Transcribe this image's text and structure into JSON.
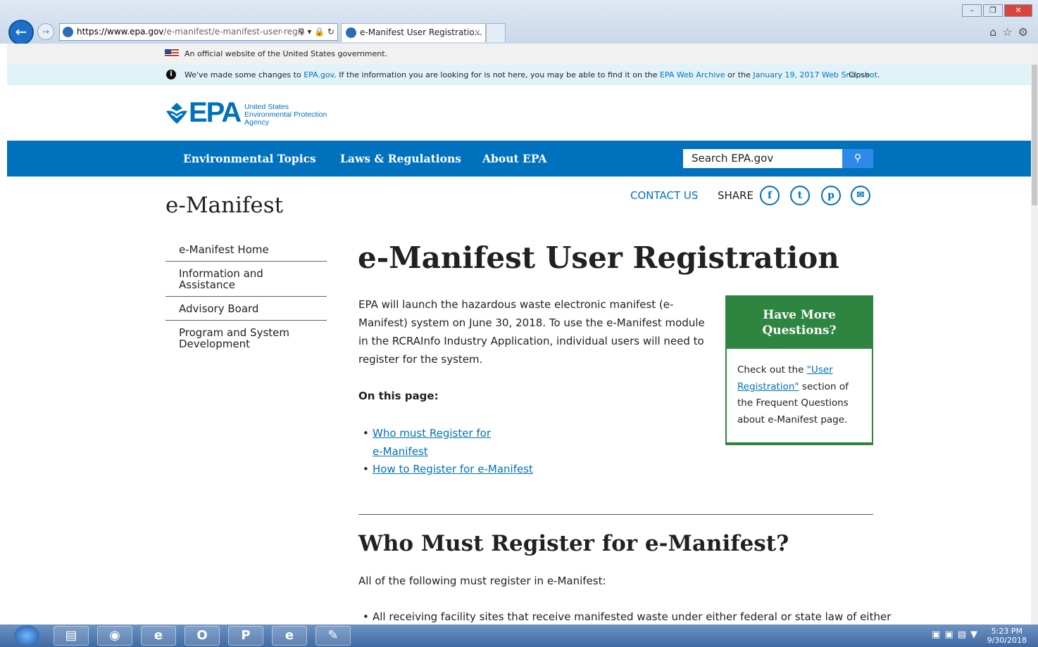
{
  "browser": {
    "url_domain": "https://www.epa.gov",
    "url_path": "/e-manifest/e-manifest-user-regis",
    "tab_title": "e-Manifest User Registratio...",
    "tab_close": "×",
    "window_minimize": "–",
    "window_restore": "❐",
    "window_close": "✕",
    "address_tools": "⚲ ▾ 🔒 ↻"
  },
  "gov_banner": {
    "text": "An official website of the United States government."
  },
  "notice": {
    "text_before": "We've made some changes to ",
    "link1": "EPA.gov",
    "text_mid1": ". If the information you are looking for is not here, you may be able to find it on the ",
    "link2": "EPA Web Archive",
    "text_mid2": " or the ",
    "link3": "January 19, 2017 Web Snapshot",
    "text_after": ".",
    "close": "Close"
  },
  "logo": {
    "word": "EPA",
    "agency_line1": "United States",
    "agency_line2": "Environmental Protection",
    "agency_line3": "Agency"
  },
  "nav": {
    "items": [
      "Environmental Topics",
      "Laws & Regulations",
      "About EPA"
    ],
    "search_placeholder": "Search EPA.gov",
    "search_button_icon": "search-icon"
  },
  "site_title": "e-Manifest",
  "header_links": {
    "contact": "CONTACT US",
    "share": "SHARE"
  },
  "sidenav": {
    "items": [
      "e-Manifest Home",
      "Information and Assistance",
      "Advisory Board",
      "Program and System Development"
    ]
  },
  "main": {
    "title": "e-Manifest User Registration",
    "intro": "EPA will launch the hazardous waste electronic manifest (e-Manifest) system on June 30, 2018. To use the e-Manifest module in the RCRAInfo Industry Application, individual users will need to register for the system.",
    "on_this_page": "On this page:",
    "toc": [
      "Who must Register for e-Manifest",
      "How to Register for e-Manifest"
    ],
    "section_title": "Who Must Register for e-Manifest?",
    "section_intro": "All of the following must register in e-Manifest:",
    "section_item": "All receiving facility sites that receive manifested waste under either federal or state law of either"
  },
  "sidebox": {
    "title": "Have More Questions?",
    "text_before": "Check out the ",
    "link": "\"User Registration\"",
    "text_after": " section of the Frequent Questions about e-Manifest page."
  },
  "taskbar": {
    "clock_time": "5:23 PM",
    "clock_date": "9/30/2018"
  },
  "colors": {
    "epa_blue": "#0071bc",
    "green": "#2e8540",
    "notice_bg": "#e1f3f8"
  }
}
